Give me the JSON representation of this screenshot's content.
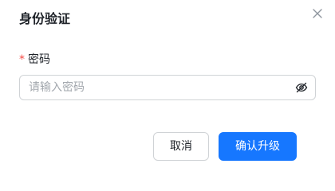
{
  "dialog": {
    "title": "身份验证",
    "close_icon": "close-icon"
  },
  "form": {
    "password": {
      "required_mark": "*",
      "label": "密码",
      "placeholder": "请输入密码",
      "value": "",
      "toggle_icon": "eye-off-icon"
    }
  },
  "footer": {
    "cancel_label": "取消",
    "confirm_label": "确认升级"
  },
  "colors": {
    "primary": "#1677ff",
    "required": "#f54a45",
    "border": "#d0d3d6",
    "text": "#1f2329",
    "placeholder": "#a3a8ae"
  }
}
